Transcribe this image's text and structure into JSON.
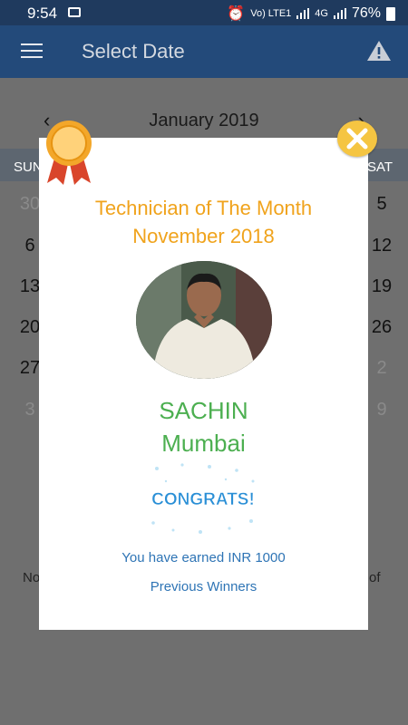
{
  "status_bar": {
    "time": "9:54",
    "network_label": "Vo) LTE1",
    "network_type": "4G",
    "battery": "76%"
  },
  "app_bar": {
    "title": "Select Date"
  },
  "calendar": {
    "month": "January 2019",
    "weekday_first": "SUN",
    "weekday_last": "SAT",
    "rows": [
      {
        "left": "30",
        "right": "5",
        "left_muted": true,
        "right_muted": false
      },
      {
        "left": "6",
        "right": "12",
        "left_muted": false,
        "right_muted": false
      },
      {
        "left": "13",
        "right": "19",
        "left_muted": false,
        "right_muted": false
      },
      {
        "left": "20",
        "right": "26",
        "left_muted": false,
        "right_muted": false
      },
      {
        "left": "27",
        "right": "2",
        "left_muted": false,
        "right_muted": true
      },
      {
        "left": "3",
        "right": "9",
        "left_muted": true,
        "right_muted": true
      }
    ],
    "note_left": "No",
    "note_right": "of"
  },
  "dialog": {
    "title_line1": "Technician of The Month",
    "title_line2": "November 2018",
    "name": "SACHIN",
    "city": "Mumbai",
    "congrats_text": "CONGRATS!",
    "earned_text": "You have earned INR 1000",
    "previous_winners": "Previous Winners"
  },
  "colors": {
    "app_bar": "#234a7a",
    "status_bar": "#1f3a5e",
    "title_orange": "#f0a31c",
    "name_green": "#4caf50",
    "link_blue": "#2e74b5",
    "close_yellow": "#f5c542"
  },
  "icons": {
    "menu": "hamburger-menu-icon",
    "warning": "warning-triangle-icon",
    "close": "close-x-icon",
    "award": "award-ribbon-icon"
  }
}
